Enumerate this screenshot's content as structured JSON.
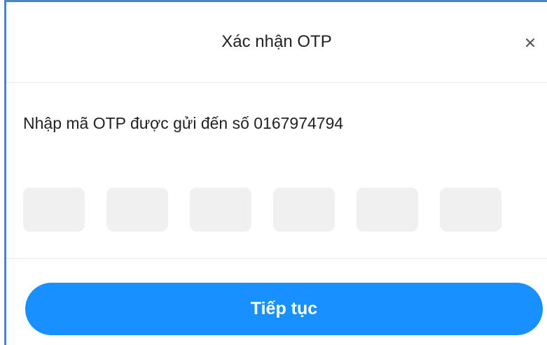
{
  "dialog": {
    "title": "Xác nhận OTP",
    "close_icon": "close-icon",
    "message": "Nhập mã OTP được gửi đến số 0167974794",
    "otp_boxes": [
      "",
      "",
      "",
      "",
      "",
      ""
    ],
    "submit_label": "Tiếp tục"
  },
  "colors": {
    "accent": "#1890ff",
    "input_bg": "#f0f0f0",
    "frame_border": "#4a86c5"
  }
}
